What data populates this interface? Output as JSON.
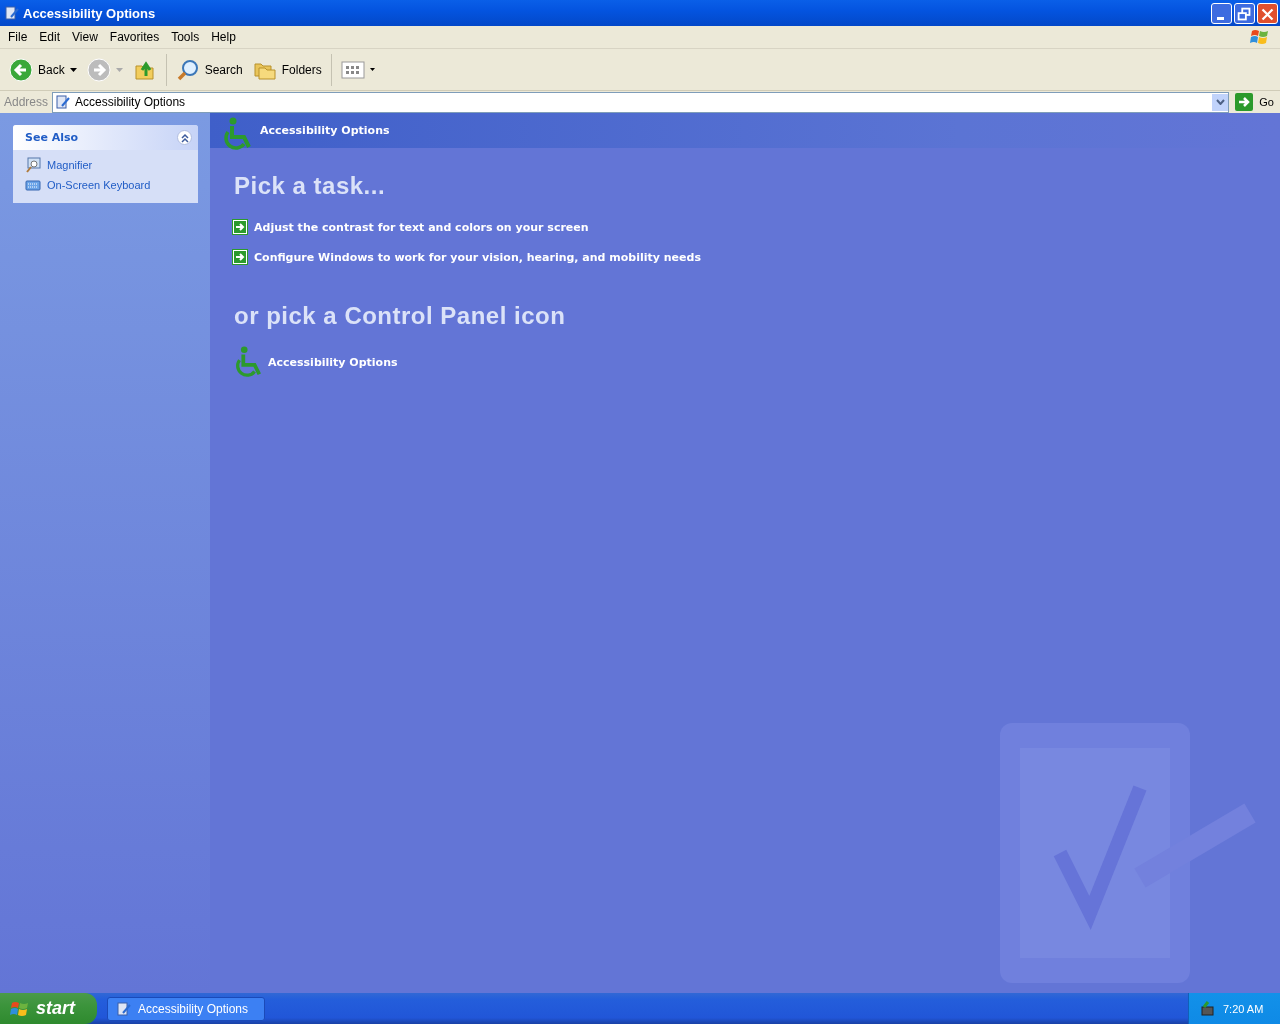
{
  "window": {
    "title": "Accessibility Options"
  },
  "menu": [
    "File",
    "Edit",
    "View",
    "Favorites",
    "Tools",
    "Help"
  ],
  "toolbar": {
    "back": "Back",
    "search": "Search",
    "folders": "Folders"
  },
  "address": {
    "label": "Address",
    "value": "Accessibility Options",
    "go": "Go"
  },
  "see_also": {
    "title": "See Also",
    "expanded": true,
    "items": [
      {
        "kind": "magnifier",
        "label": "Magnifier"
      },
      {
        "kind": "keyboard",
        "label": "On-Screen Keyboard"
      }
    ]
  },
  "header": {
    "title": "Accessibility Options"
  },
  "tasks": {
    "heading": "Pick a task...",
    "items": [
      "Adjust the contrast for text and colors on your screen",
      "Configure Windows to work for your vision, hearing, and mobility needs"
    ]
  },
  "icons": {
    "heading": "or pick a Control Panel icon",
    "items": [
      "Accessibility Options"
    ]
  },
  "taskbar": {
    "start": "start",
    "windows": [
      {
        "label": "Accessibility Options",
        "selected": false
      }
    ],
    "clock": "7:20 AM"
  }
}
